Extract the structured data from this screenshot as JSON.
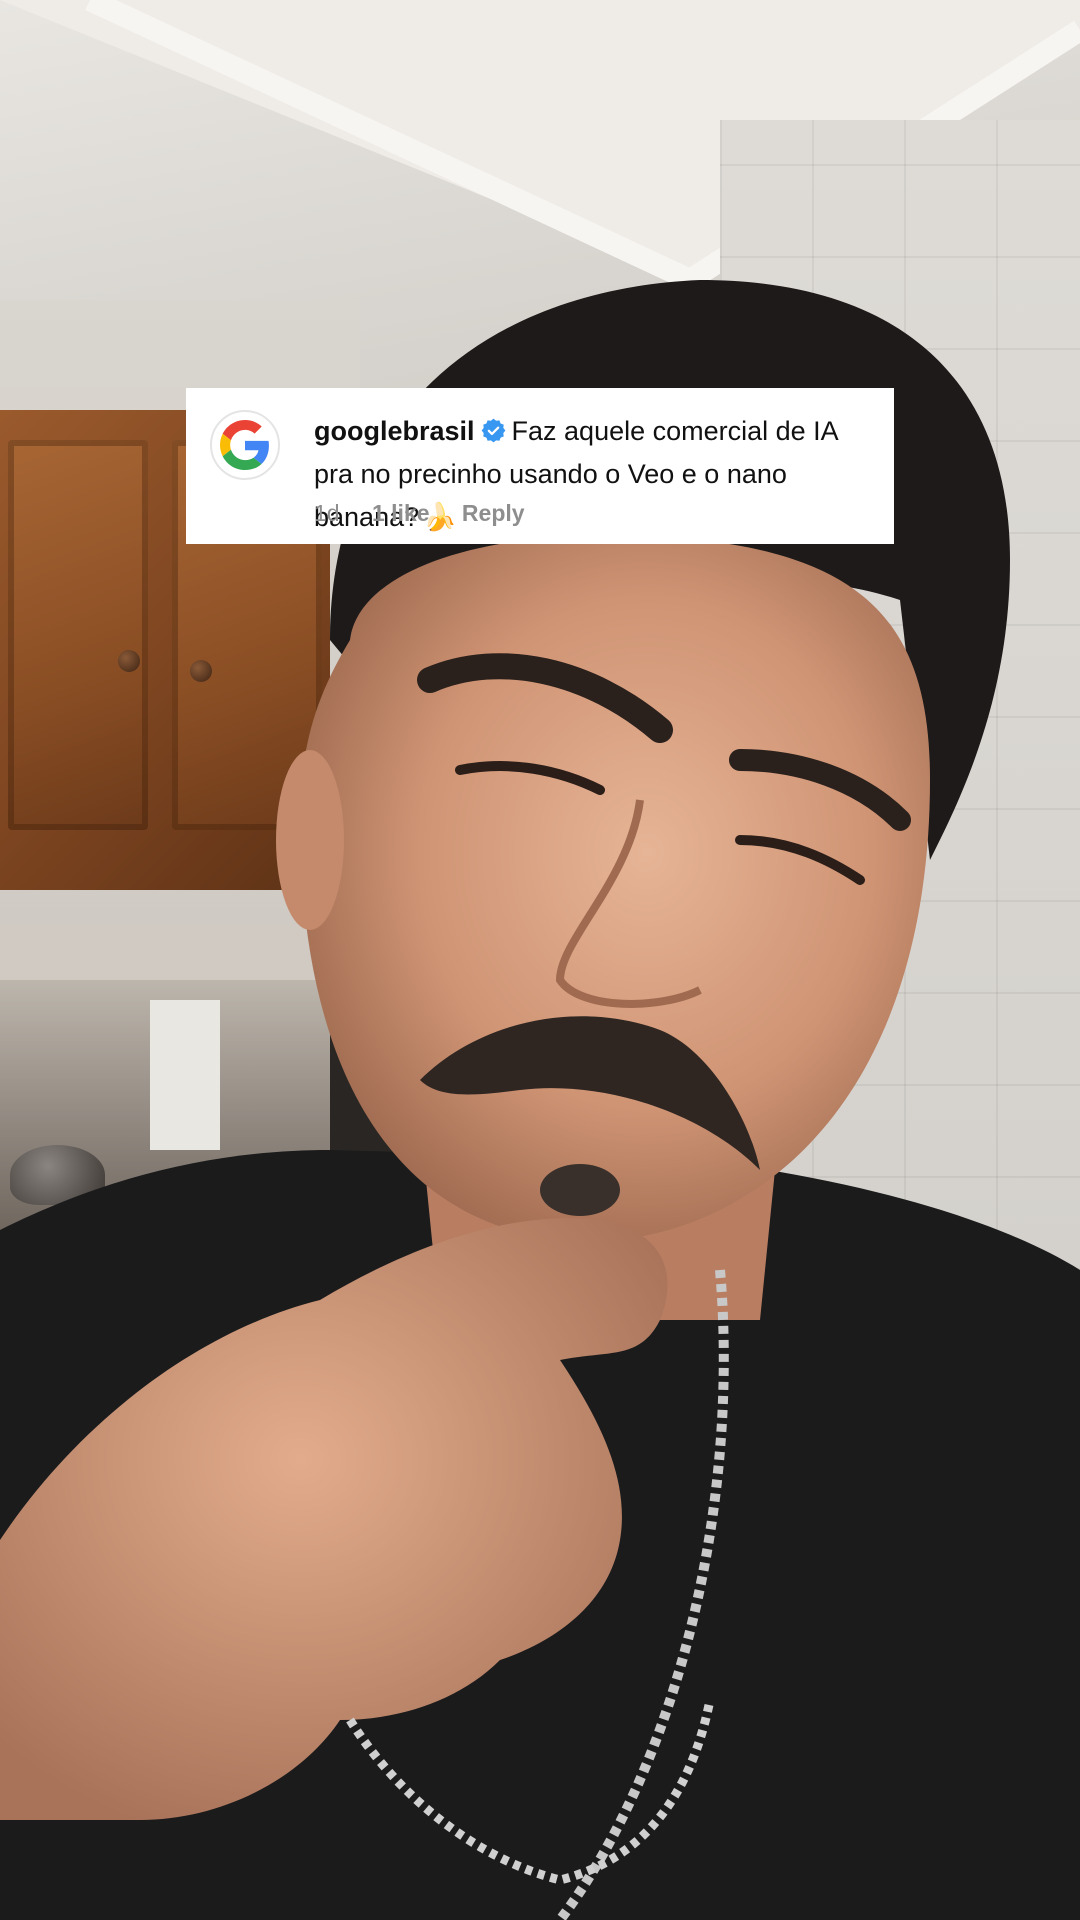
{
  "comment": {
    "avatar_icon": "google-g-logo",
    "username": "googlebrasil",
    "verified_icon": "verified-badge-icon",
    "text": "Faz aquele comercial de IA pra no precinho usando o Veo e o nano banana?",
    "emoji": "🍌",
    "time_ago": "1d",
    "likes": "1 like",
    "reply_label": "Reply"
  },
  "colors": {
    "verified_badge": "#3897f0",
    "meta_text": "#8e8e8e",
    "google_blue": "#4285F4",
    "google_red": "#EA4335",
    "google_yellow": "#FBBC05",
    "google_green": "#34A853"
  },
  "background": {
    "description_icon": "video-frame-person"
  }
}
